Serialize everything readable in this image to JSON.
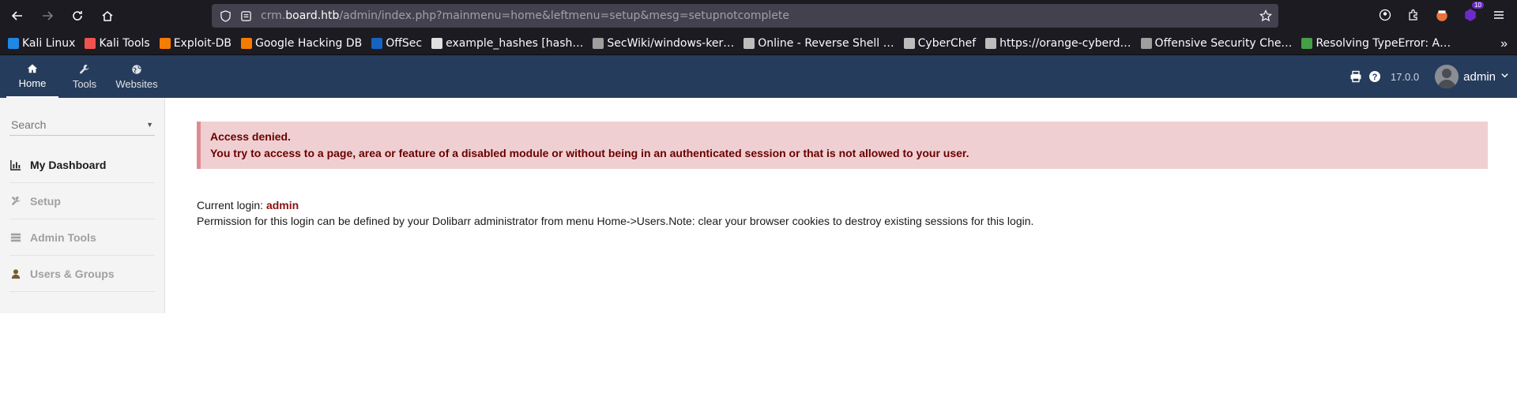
{
  "browser": {
    "url_prefix": "crm.",
    "url_host": "board.htb",
    "url_path": "/admin/index.php?mainmenu=home&leftmenu=setup&mesg=setupnotcomplete",
    "extension_badge": "10",
    "bookmarks": [
      {
        "label": "Kali Linux",
        "color": "#1e88e5"
      },
      {
        "label": "Kali Tools",
        "color": "#ef5350"
      },
      {
        "label": "Exploit-DB",
        "color": "#f57c00"
      },
      {
        "label": "Google Hacking DB",
        "color": "#f57c00"
      },
      {
        "label": "OffSec",
        "color": "#1565c0"
      },
      {
        "label": "example_hashes [hash…",
        "color": "#e0e0e0"
      },
      {
        "label": "SecWiki/windows-ker…",
        "color": "#9e9e9e"
      },
      {
        "label": "Online - Reverse Shell …",
        "color": "#bdbdbd"
      },
      {
        "label": "CyberChef",
        "color": "#bdbdbd"
      },
      {
        "label": "https://orange-cyberd…",
        "color": "#bdbdbd"
      },
      {
        "label": "Offensive Security Che…",
        "color": "#9e9e9e"
      },
      {
        "label": "Resolving TypeError: A…",
        "color": "#43a047"
      }
    ]
  },
  "topbar": {
    "menu": [
      {
        "label": "Home",
        "icon": "home-icon"
      },
      {
        "label": "Tools",
        "icon": "wrench-icon"
      },
      {
        "label": "Websites",
        "icon": "globe-icon"
      }
    ],
    "version": "17.0.0",
    "username": "admin"
  },
  "sidebar": {
    "search_placeholder": "Search",
    "items": [
      {
        "label": "My Dashboard",
        "icon": "chart-icon",
        "active": true
      },
      {
        "label": "Setup",
        "icon": "tools-icon",
        "active": false
      },
      {
        "label": "Admin Tools",
        "icon": "server-icon",
        "active": false
      },
      {
        "label": "Users & Groups",
        "icon": "user-icon",
        "active": false
      }
    ]
  },
  "content": {
    "error_title": "Access denied.",
    "error_message": "You try to access to a page, area or feature of a disabled module or without being in an authenticated session or that is not allowed to your user.",
    "current_login_label": "Current login:",
    "current_login_user": "admin",
    "permission_note": "Permission for this login can be defined by your Dolibarr administrator from menu Home->Users.Note: clear your browser cookies to destroy existing sessions for this login."
  }
}
